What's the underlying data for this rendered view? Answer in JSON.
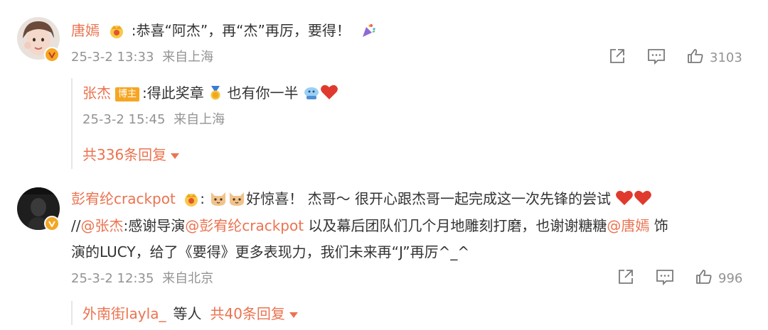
{
  "comments": [
    {
      "user": "唐嫣",
      "text": ":恭喜“阿杰”，再“杰”再厉，要得！",
      "time": "25-3-2 13:33",
      "location": "来自上海",
      "likes": "3103",
      "reply": {
        "user": "张杰",
        "tag": "博主",
        "text_before": ":得此奖章",
        "text_after": "也有你一半",
        "time": "25-3-2 15:45",
        "location": "来自上海"
      },
      "more_replies": "共336条回复"
    },
    {
      "user": "彭宥纶crackpot",
      "line1_prefix": ":",
      "line1_text": "好惊喜！ 杰哥～ 很开心跟杰哥一起完成这一次先锋的尝试",
      "line2_sep": "//",
      "line2_mention1": "@张杰",
      "line2_text1": ":感谢导演",
      "line2_mention2": "@彭宥纶crackpot",
      "line2_text2": " 以及幕后团队们几个月地雕刻打磨，也谢谢糖糖",
      "line2_mention3": "@唐嫣",
      "line2_text3": " 饰",
      "line3_text": "演的LUCY，给了《要得》更多表现力，我们未来再“J”再厉^_^",
      "time": "25-3-2 12:35",
      "location": "来自北京",
      "likes": "996",
      "reply_users": "外南街layla_",
      "reply_users_suffix": "等人",
      "more_replies": "共40条回复"
    }
  ],
  "colors": {
    "username": "#eb7350",
    "text": "#333333",
    "meta": "#939393",
    "tag_bozhu": "#f6a623",
    "verified_badge": "#f5a623",
    "heart": "#e03a2e"
  },
  "icons": [
    "share-icon",
    "comment-icon",
    "like-icon",
    "crown-icon",
    "party-popper-icon",
    "medal-icon",
    "heart-icon",
    "cat-emoji-icon",
    "caret-down-icon",
    "verified-badge-icon"
  ]
}
